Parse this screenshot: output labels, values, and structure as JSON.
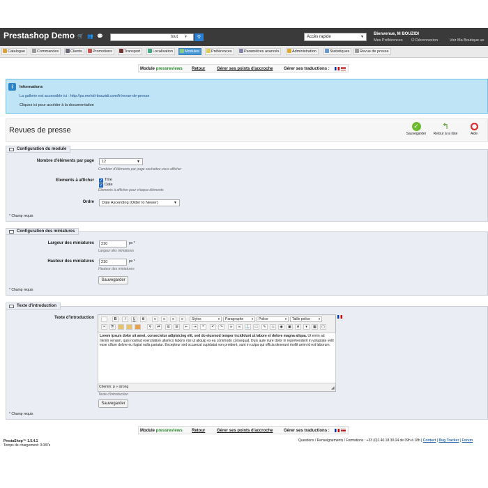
{
  "header": {
    "title": "Prestashop Demo",
    "search_value": "",
    "search_scope": "tout",
    "quick_access": "Accès rapide",
    "welcome": "Bienvenue, M BOUZIDI",
    "my_prefs": "Mes Préférences",
    "logout": "Déconnexion",
    "view_shop": "Voir Ma Boutique ue"
  },
  "tabs": [
    "Catalogue",
    "Commandes",
    "Clients",
    "Promotions",
    "Transport",
    "Localisation",
    "Modules",
    "Préférences",
    "Paramètres avancés",
    "Administration",
    "Statistiques",
    "Revue de presse"
  ],
  "modbar": {
    "module_prefix": "Module ",
    "module_name": "pressreviews",
    "back": "Retour",
    "hooks": "Gérer ses points d'accroche",
    "translations": "Gérer ses traductions :"
  },
  "info": {
    "title": "Informations",
    "line1": "La gallerie est accessible ici : http://ps.mehdi-bouzidi.com/fr/revue-de-presse",
    "line2": "Cliquez ici pour accéder à la documentation"
  },
  "page": {
    "title": "Revues de presse",
    "save": "Sauvegarder",
    "back_list": "Retour à la liste",
    "help": "Aide"
  },
  "config": {
    "legend": "Configuration du module",
    "items_label": "Nombre d'éléments par page",
    "items_value": "12",
    "items_hint": "Combien d'éléments par page souhaitez-vous afficher",
    "display_label": "Elements à afficher",
    "opt_title": "Titre",
    "opt_date": "Date",
    "display_hint": "Elements à afficher pour chaque éléments",
    "order_label": "Ordre",
    "order_value": "Date Ascending (Older to Newer)",
    "required": "* Champ requis"
  },
  "thumbs": {
    "legend": "Configuration des miniatures",
    "width_label": "Largeur des miniatures",
    "width_value": "210",
    "width_unit": "px *",
    "width_hint": "Largeur des miniatures",
    "height_label": "Hauteur des miniatures",
    "height_value": "210",
    "height_unit": "px *",
    "height_hint": "Hauteur des miniatures",
    "save": "Sauvegarder",
    "required": "* Champ requis"
  },
  "intro": {
    "legend": "Texte d'introduction",
    "label": "Texte d'introduction",
    "dd_styles": "Styles",
    "dd_para": "Paragraphe",
    "dd_font": "Police",
    "dd_size": "Taille police",
    "text_bold": "Lorem ipsum dolor sit amet, consectetur adipisicing elit, sed do eiusmod tempor incididunt ut labore et dolore magna aliqua.",
    "text_rest": " Ut enim ad minim veniam, quis nostrud exercitation ullamco laboris nisi ut aliquip ex ea commodo consequat. Duis aute irure dolor in reprehenderit in voluptate velit esse cillum dolore eu fugiat nulla pariatur. Excepteur sint occaecat cupidatat non proident, sunt in culpa qui officia deserunt mollit anim id est laborum.",
    "path": "Chemin: p » strong",
    "hint": "Texte d'introduction",
    "save": "Sauvegarder",
    "required": "* Champ requis"
  },
  "footer": {
    "version": "PrestaShop™ 1.5.4.1",
    "load_time": "Temps de chargement: 0.087s",
    "contact_text": "Questions / Renseignements / Formations : +33 (0)1.40.18.30.04 de 09h à 18h |",
    "contact": "Contact",
    "bug": "Bug Tracker",
    "forum": "Forum"
  }
}
